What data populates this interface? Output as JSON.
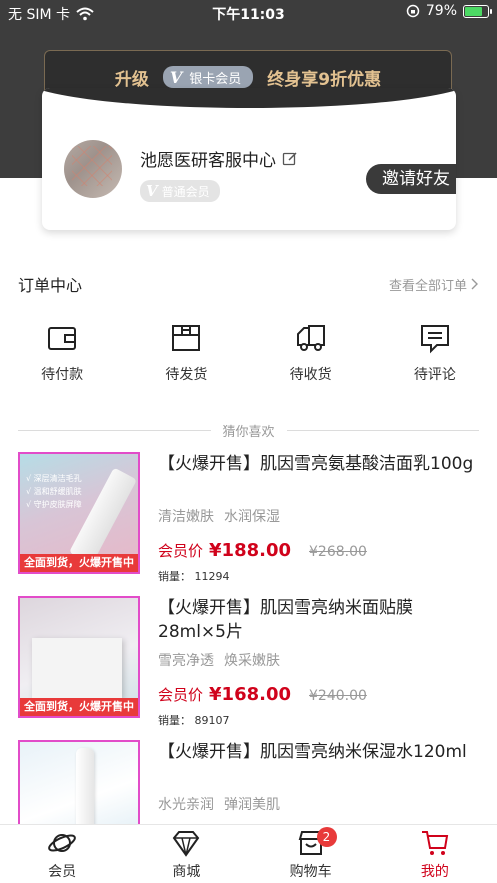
{
  "status_bar": {
    "carrier": "无 SIM 卡",
    "time": "下午11:03",
    "battery": "79%"
  },
  "vip_banner": {
    "prefix": "升级",
    "badge_label": "银卡会员",
    "suffix": "终身享9折优惠"
  },
  "profile": {
    "name": "池愿医研客服中心",
    "member_level": "普通会员",
    "invite_label": "邀请好友"
  },
  "order_center": {
    "title": "订单中心",
    "view_all": "查看全部订单",
    "items": [
      {
        "label": "待付款",
        "icon": "wallet-icon"
      },
      {
        "label": "待发货",
        "icon": "package-icon"
      },
      {
        "label": "待收货",
        "icon": "truck-icon"
      },
      {
        "label": "待评论",
        "icon": "comment-icon"
      }
    ]
  },
  "recommend": {
    "title": "猜你喜欢",
    "products": [
      {
        "title": "【火爆开售】肌因雪亮氨基酸洁面乳100g",
        "tags": [
          "清洁嫩肤",
          "水润保湿"
        ],
        "price_label": "会员价",
        "price": "¥188.00",
        "orig_price": "¥268.00",
        "sales": "销量： 11294",
        "image_text": "全面到货，火爆开售中",
        "image_lines": [
          "深层清洁毛孔",
          "温和舒缓肌肤",
          "守护皮肤屏障"
        ]
      },
      {
        "title": "【火爆开售】肌因雪亮纳米面贴膜28ml×5片",
        "tags": [
          "雪亮净透",
          "焕采嫩肤"
        ],
        "price_label": "会员价",
        "price": "¥168.00",
        "orig_price": "¥240.00",
        "sales": "销量： 89107",
        "image_text": "全面到货，火爆开售中"
      },
      {
        "title": "【火爆开售】肌因雪亮纳米保湿水120ml",
        "tags": [
          "水光亲润",
          "弹润美肌"
        ]
      }
    ]
  },
  "tab_bar": {
    "tabs": [
      {
        "label": "会员",
        "icon": "planet-icon"
      },
      {
        "label": "商城",
        "icon": "diamond-icon"
      },
      {
        "label": "购物车",
        "icon": "shop-icon",
        "badge": "2"
      },
      {
        "label": "我的",
        "icon": "cart-icon"
      }
    ],
    "active_color": "#d0021b"
  }
}
